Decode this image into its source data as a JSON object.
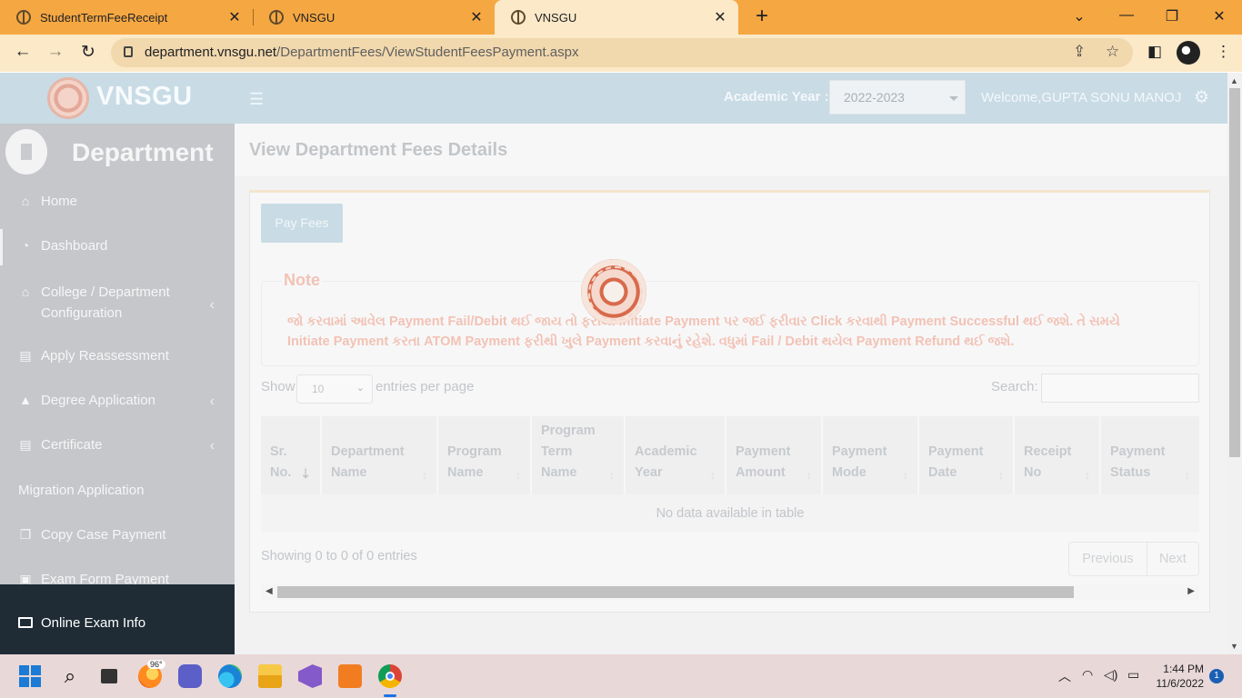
{
  "browser": {
    "tabs": [
      {
        "title": "StudentTermFeeReceipt"
      },
      {
        "title": "VNSGU"
      },
      {
        "title": "VNSGU"
      }
    ],
    "url_domain": "department.vnsgu.net",
    "url_path": "/DepartmentFees/ViewStudentFeesPayment.aspx"
  },
  "header": {
    "logo_text": "VNSGU",
    "academic_year_label": "Academic Year :",
    "academic_year_value": "2022-2023",
    "welcome_text": "Welcome,GUPTA SONU MANOJ"
  },
  "sidebar": {
    "title": "Department",
    "items": [
      {
        "label": "Home",
        "icon": "home-icon"
      },
      {
        "label": "Dashboard",
        "icon": "dashboard-icon"
      },
      {
        "label": "College / Department Configuration",
        "icon": "bank-icon"
      },
      {
        "label": "Apply Reassessment",
        "icon": "book-icon"
      },
      {
        "label": "Degree Application",
        "icon": "graduation-cap-icon"
      },
      {
        "label": "Certificate",
        "icon": "book-icon"
      },
      {
        "label": "Migration Application",
        "icon": ""
      },
      {
        "label": "Copy Case Payment",
        "icon": "copy-icon"
      },
      {
        "label": "Exam Form Payment",
        "icon": "money-icon"
      }
    ],
    "footer_item": "Online Exam Info"
  },
  "main": {
    "page_title": "View Department Fees Details",
    "pay_fees_label": "Pay Fees",
    "note_label": "Note",
    "note_text_line1": "જો કરવામાં આવેલ Payment Fail/Debit થઈ જાય તો ફરીથી Initiate Payment પર જઈ ફરીવાર Click કરવાથી Payment Successful થઈ જશે. તે સમયે",
    "note_text_line2": "Initiate Payment કરતા ATOM Payment ફરીથી ખુલે Payment કરવાનું રહેશે. વધુમાં Fail / Debit થયેલ Payment Refund થઈ જશે.",
    "show_label": "Show",
    "page_length": "10",
    "entries_label": "entries per page",
    "search_label": "Search:",
    "search_value": "",
    "columns": [
      "Sr. No.",
      "Department Name",
      "Program Name",
      "Program Term Name",
      "Academic Year",
      "Payment Amount",
      "Payment Mode",
      "Payment Date",
      "Receipt No",
      "Payment Status"
    ],
    "empty_message": "No data available in table",
    "info_text": "Showing 0 to 0 of 0 entries",
    "prev_label": "Previous",
    "next_label": "Next"
  },
  "taskbar": {
    "weather_badge": "96°",
    "time": "1:44 PM",
    "date": "11/6/2022",
    "notification_count": "1"
  }
}
